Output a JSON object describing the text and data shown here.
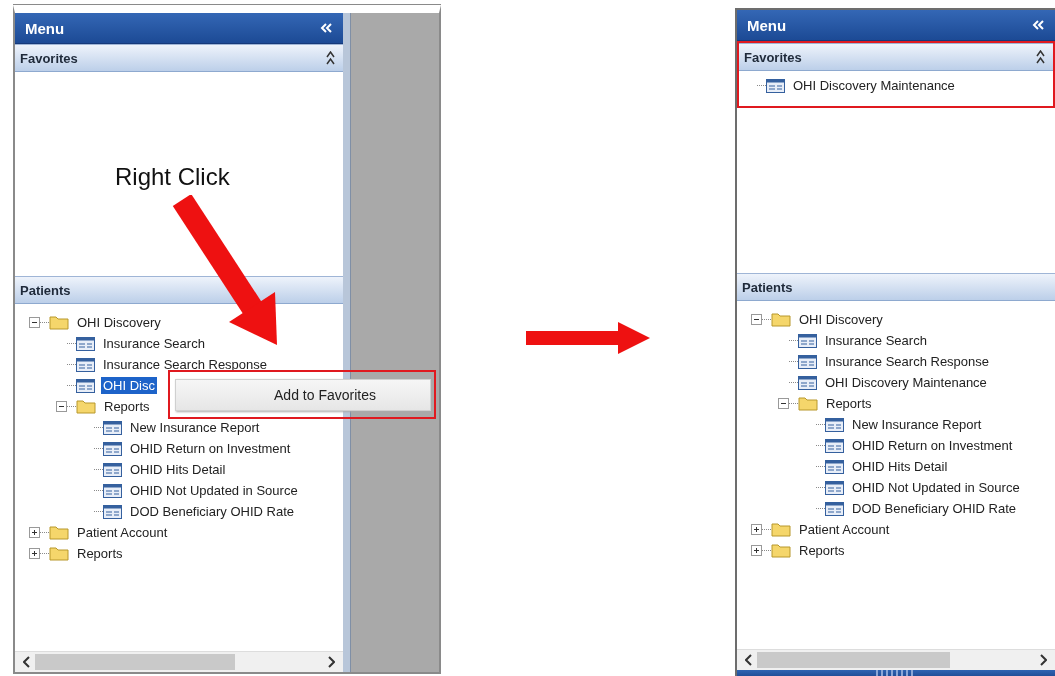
{
  "screens": [
    {
      "kind": "panel_with_workspace",
      "menu": {
        "title": "Menu"
      },
      "favorites": {
        "title": "Favorites",
        "highlighted": false
      },
      "patients": {
        "title": "Patients",
        "tree": [
          {
            "label": "OHI Discovery",
            "kind": "folder",
            "expanded": true,
            "selected": false,
            "children": [
              {
                "label": "Insurance Search",
                "kind": "page",
                "selected": false
              },
              {
                "label": "Insurance Search Response",
                "kind": "page",
                "selected": false
              },
              {
                "label": "OHI Disc",
                "kind": "page",
                "selected": true
              },
              {
                "label": "Reports",
                "kind": "folder",
                "expanded": true,
                "selected": false,
                "children": [
                  {
                    "label": "New Insurance Report",
                    "kind": "page",
                    "selected": false
                  },
                  {
                    "label": "OHID Return on Investment",
                    "kind": "page",
                    "selected": false
                  },
                  {
                    "label": "OHID Hits Detail",
                    "kind": "page",
                    "selected": false
                  },
                  {
                    "label": "OHID Not Updated in Source",
                    "kind": "page",
                    "selected": false
                  },
                  {
                    "label": "DOD Beneficiary OHID Rate",
                    "kind": "page",
                    "selected": false
                  }
                ]
              }
            ]
          },
          {
            "label": "Patient Account",
            "kind": "folder",
            "expanded": false,
            "selected": false
          },
          {
            "label": "Reports",
            "kind": "folder",
            "expanded": false,
            "selected": false
          }
        ]
      },
      "annotation": {
        "text": "Right Click"
      },
      "context_menu": {
        "highlighted": true,
        "items": [
          {
            "label": "Add to Favorites"
          }
        ]
      }
    },
    {
      "kind": "panel",
      "menu": {
        "title": "Menu"
      },
      "favorites": {
        "title": "Favorites",
        "highlighted": true,
        "items": [
          {
            "label": "OHI Discovery Maintenance",
            "selected": false
          }
        ]
      },
      "patients": {
        "title": "Patients",
        "tree": [
          {
            "label": "OHI Discovery",
            "kind": "folder",
            "expanded": true,
            "selected": false,
            "children": [
              {
                "label": "Insurance Search",
                "kind": "page",
                "selected": false
              },
              {
                "label": "Insurance Search Response",
                "kind": "page",
                "selected": false
              },
              {
                "label": "OHI Discovery Maintenance",
                "kind": "page",
                "selected": false
              },
              {
                "label": "Reports",
                "kind": "folder",
                "expanded": true,
                "selected": false,
                "children": [
                  {
                    "label": "New Insurance Report",
                    "kind": "page",
                    "selected": false
                  },
                  {
                    "label": "OHID Return on Investment",
                    "kind": "page",
                    "selected": false
                  },
                  {
                    "label": "OHID Hits Detail",
                    "kind": "page",
                    "selected": false
                  },
                  {
                    "label": "OHID Not Updated in Source",
                    "kind": "page",
                    "selected": false
                  },
                  {
                    "label": "DOD Beneficiary OHID Rate",
                    "kind": "page",
                    "selected": false
                  }
                ]
              }
            ]
          },
          {
            "label": "Patient Account",
            "kind": "folder",
            "expanded": false,
            "selected": false
          },
          {
            "label": "Reports",
            "kind": "folder",
            "expanded": false,
            "selected": false
          }
        ]
      }
    }
  ]
}
